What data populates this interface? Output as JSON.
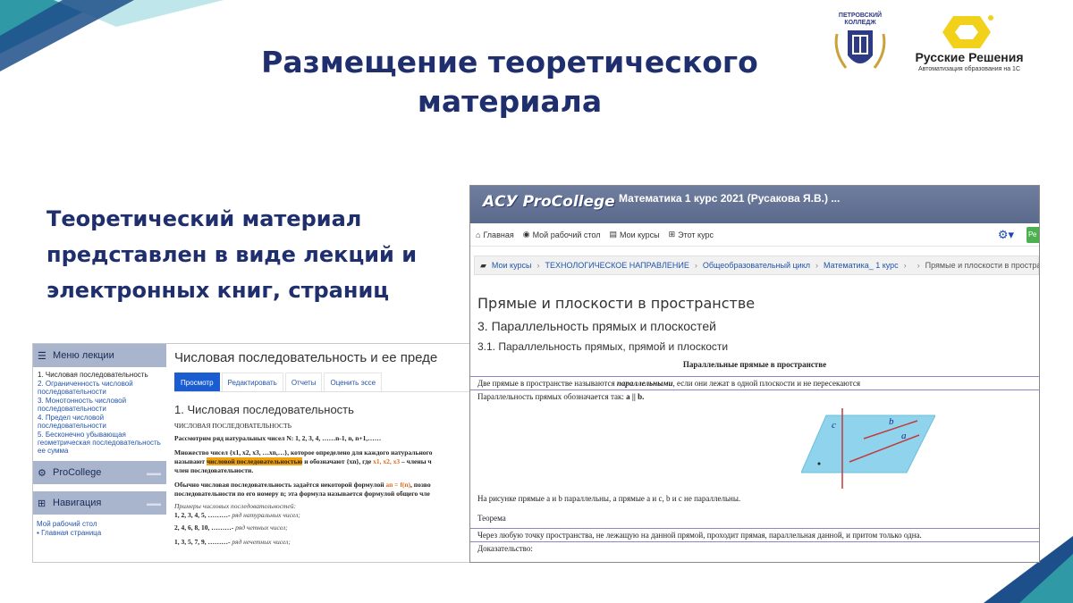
{
  "slide": {
    "title": "Размещение теоретического материала",
    "subtitle": "Теоретический материал представлен в виде лекций и электронных книг, страниц"
  },
  "logos": {
    "college_name": "ПЕТРОВСКИЙ КОЛЛЕДЖ",
    "partner_name": "Русские Решения",
    "partner_tagline": "Автоматизация образования на 1С"
  },
  "left_screen": {
    "lecture_menu_title": "Меню лекции",
    "lecture_menu_items": [
      "1. Числовая последовательность",
      "2. Ограниченность числовой последовательности",
      "3. Монотонность числовой последовательности",
      "4. Предел числовой последовательности",
      "5. Бесконечно убывающая геометрическая последовательность ее сумма"
    ],
    "procollege_block": "ProCollege",
    "navigation_block": "Навигация",
    "nav_items": [
      "Мой рабочий стол",
      "Главная страница"
    ],
    "page_title": "Числовая последовательность и ее преде",
    "tabs": [
      "Просмотр",
      "Редактировать",
      "Отчеты",
      "Оценить эссе"
    ],
    "section_title": "1. Числовая последовательность",
    "text": {
      "heading": "ЧИСЛОВАЯ ПОСЛЕДОВАТЕЛЬНОСТЬ",
      "line1": "Рассмотрим ряд натуральных чисел N: 1, 2, 3, 4, ……n-1, n, n+1,……",
      "line2": "Множество чисел {x1, x2, x3, …xn,…}, которое определено для каждого натурального",
      "line3_pre": "называют ",
      "line3_hl": "числовой последовательностью",
      "line3_mid": " и обозначают {xn}, где ",
      "line3_or": "x1, x2, x3",
      "line3_post": " – члены ч",
      "line4": "член последовательности.",
      "line5_pre": "Обычно числовая последовательность задаётся некоторой формулой ",
      "line5_or": "an = f(n)",
      "line5_post": ", позво",
      "line6": "последовательности по его номеру n; эта формула называется формулой общего чле",
      "line7": "Примеры числовых последовательностей:",
      "line8_pre": "1, 2, 3, 4, 5, ………- ",
      "line8_it": "ряд натуральных чисел;",
      "line9_pre": "2, 4, 6, 8, 10, ………- ",
      "line9_it": "ряд четных чисел;",
      "line10_pre": "1, 3, 5, 7, 9, ………- ",
      "line10_it": "ряд нечетных чисел;"
    }
  },
  "right_screen": {
    "brand": "АСУ ProCollege",
    "course": "Математика 1 курс 2021 (Русакова Я.В.) ...",
    "nav": [
      "Главная",
      "Мой рабочий стол",
      "Мои курсы",
      "Этот курс"
    ],
    "green_button": "Ре",
    "breadcrumbs": [
      "Мои курсы",
      "ТЕХНОЛОГИЧЕСКОЕ НАПРАВЛЕНИЕ",
      "Общеобразовательный цикл",
      "Математика_ 1 курс",
      "",
      "Прямые и плоскости в пространств"
    ],
    "h1": "Прямые и плоскости в пространстве",
    "h2": "3. Параллельность прямых и плоскостей",
    "h3": "3.1. Параллельность прямых, прямой и плоскости",
    "center_title": "Параллельные прямые в пространстве",
    "def_pre": "Две прямые в пространстве называются ",
    "def_term": "параллельными",
    "def_post": ", если они лежат в одной плоскости и не пересекаются",
    "notation_pre": "Параллельность прямых обозначается так: ",
    "notation_formula": "a || b.",
    "figure_labels": [
      "c",
      "b",
      "a"
    ],
    "caption": "На рисунке прямые a и b параллельны, а прямые a и c, b и c  не параллельны.",
    "theorem": "Теорема",
    "theorem_text": "Через любую точку пространства, не лежащую на данной прямой, проходит прямая, параллельная данной, и притом только одна.",
    "proof": "Доказательство:"
  }
}
